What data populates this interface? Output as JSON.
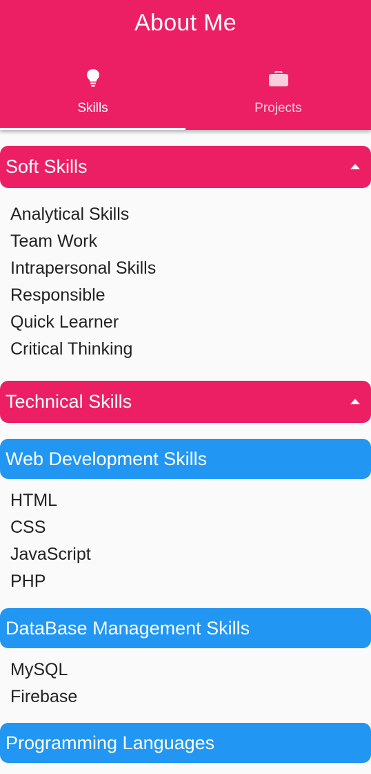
{
  "appbar": {
    "title": "About Me",
    "color": "#ec1f64"
  },
  "tabs": [
    {
      "label": "Skills",
      "icon": "lightbulb-icon",
      "selected": true
    },
    {
      "label": "Projects",
      "icon": "briefcase-icon",
      "selected": false
    }
  ],
  "soft_skills": {
    "title": "Soft Skills",
    "expanded": true,
    "items": [
      "Analytical Skills",
      "Team Work",
      "Intrapersonal Skills",
      "Responsible",
      "Quick Learner",
      "Critical Thinking"
    ]
  },
  "technical_skills": {
    "title": "Technical Skills",
    "expanded": true,
    "groups": [
      {
        "title": "Web Development Skills",
        "items": [
          "HTML",
          "CSS",
          "JavaScript",
          "PHP"
        ]
      },
      {
        "title": "DataBase Management Skills",
        "items": [
          "MySQL",
          "Firebase"
        ]
      },
      {
        "title": "Programming Languages",
        "items": []
      }
    ]
  },
  "colors": {
    "primary": "#ec1f64",
    "secondary": "#2196f3",
    "background": "#fafafa",
    "text": "#222222"
  }
}
